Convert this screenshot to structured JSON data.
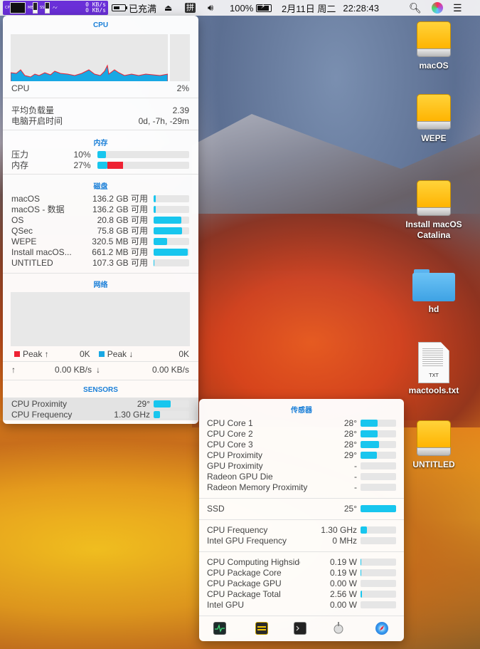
{
  "menubar": {
    "stat_labels": [
      "CPU",
      "MEM",
      "SSD",
      "NET"
    ],
    "cpu_label": "CPU",
    "mem_label": "MEM",
    "ssd_label": "SSD",
    "net_up": "0 KB/s",
    "net_down": "0 KB/s",
    "battery_status": "已充满",
    "ime": "拼",
    "battery_percent": "100%",
    "date": "2月11日 周二",
    "time": "22:28:43"
  },
  "left_panel": {
    "cpu_title": "CPU",
    "cpu_label": "CPU",
    "cpu_value": "2%",
    "load_label": "平均负载量",
    "load_value": "2.39",
    "uptime_label": "电脑开启时间",
    "uptime_value": "0d, -7h, -29m",
    "memory_title": "内存",
    "pressure_label": "压力",
    "pressure_value": "10%",
    "pressure_fraction": 0.1,
    "memory_label": "内存",
    "memory_value": "27%",
    "memory_fraction": 0.27,
    "disk_title": "磁盘",
    "disks": [
      {
        "name": "macOS",
        "free": "136.2 GB 可用",
        "fraction": 0.06
      },
      {
        "name": "macOS - 数据",
        "free": "136.2 GB 可用",
        "fraction": 0.06
      },
      {
        "name": "OS",
        "free": "20.8 GB 可用",
        "fraction": 0.78
      },
      {
        "name": "QSec",
        "free": "75.8 GB 可用",
        "fraction": 0.8
      },
      {
        "name": "WEPE",
        "free": "320.5 MB 可用",
        "fraction": 0.38
      },
      {
        "name": "Install macOS...",
        "free": "661.2 MB 可用",
        "fraction": 0.96
      },
      {
        "name": "UNTITLED",
        "free": "107.3 GB 可用",
        "fraction": 0.02
      }
    ],
    "network_title": "网络",
    "peak_up_label": "Peak ↑",
    "peak_up_value": "0K",
    "peak_down_label": "Peak ↓",
    "peak_down_value": "0K",
    "up_arrow": "↑",
    "up_value": "0.00 KB/s",
    "down_arrow": "↓",
    "down_value": "0.00 KB/s",
    "sensors_title": "SENSORS",
    "sensors": [
      {
        "name": "CPU Proximity",
        "value": "29°",
        "fraction": 0.48
      },
      {
        "name": "CPU Frequency",
        "value": "1.30 GHz",
        "fraction": 0.18
      }
    ]
  },
  "right_panel": {
    "title": "传感器",
    "temps": [
      {
        "name": "CPU Core 1",
        "value": "28°",
        "fraction": 0.48
      },
      {
        "name": "CPU Core 2",
        "value": "28°",
        "fraction": 0.48
      },
      {
        "name": "CPU Core 3",
        "value": "28°",
        "fraction": 0.52
      },
      {
        "name": "CPU Proximity",
        "value": "29°",
        "fraction": 0.46
      },
      {
        "name": "GPU Proximity",
        "value": "-",
        "fraction": 0
      },
      {
        "name": "Radeon GPU Die",
        "value": "-",
        "fraction": 0
      },
      {
        "name": "Radeon Memory Proximity",
        "value": "-",
        "fraction": 0
      }
    ],
    "ssd": {
      "name": "SSD",
      "value": "25°",
      "fraction": 1.0
    },
    "freqs": [
      {
        "name": "CPU Frequency",
        "value": "1.30 GHz",
        "fraction": 0.18
      },
      {
        "name": "Intel GPU Frequency",
        "value": "0 MHz",
        "fraction": 0
      }
    ],
    "power": [
      {
        "name": "CPU Computing Highside",
        "value": "0.19 W",
        "fraction": 0.02
      },
      {
        "name": "CPU Package Core",
        "value": "0.19 W",
        "fraction": 0.02
      },
      {
        "name": "CPU Package GPU",
        "value": "0.00 W",
        "fraction": 0
      },
      {
        "name": "CPU Package Total",
        "value": "2.56 W",
        "fraction": 0.04
      },
      {
        "name": "Intel GPU",
        "value": "0.00 W",
        "fraction": 0
      }
    ],
    "toolbar_icons": [
      "activity-monitor-icon",
      "istat-icon",
      "terminal-icon",
      "app-icon",
      "safari-icon"
    ]
  },
  "desktop": {
    "icons": [
      {
        "label": "macOS",
        "kind": "drive"
      },
      {
        "label": "WEPE",
        "kind": "drive"
      },
      {
        "label": "Install macOS Catalina",
        "kind": "drive"
      },
      {
        "label": "hd",
        "kind": "folder"
      },
      {
        "label": "mactools.txt",
        "kind": "doc",
        "badge": "TXT"
      },
      {
        "label": "UNTITLED",
        "kind": "drive"
      }
    ]
  },
  "colors": {
    "accent_blue": "#1a7fd8",
    "meter_cyan": "#18c6ee",
    "meter_red": "#ee2233",
    "menubar_stats_bg": "#6a2fd8"
  }
}
